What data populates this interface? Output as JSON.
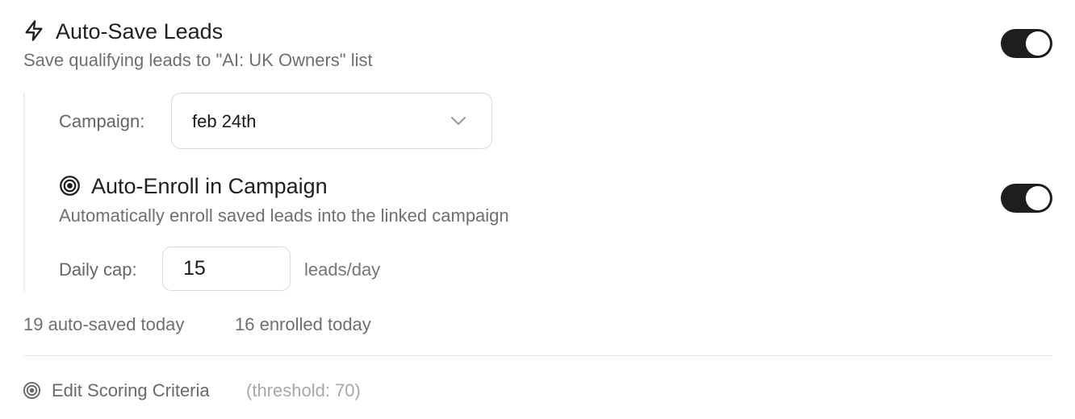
{
  "auto_save": {
    "icon": "bolt-icon",
    "title": "Auto-Save Leads",
    "description": "Save qualifying leads to \"AI: UK Owners\" list",
    "enabled": true
  },
  "campaign": {
    "label": "Campaign:",
    "selected": "feb 24th"
  },
  "auto_enroll": {
    "icon": "target-icon",
    "title": "Auto-Enroll in Campaign",
    "description": "Automatically enroll saved leads into the linked campaign",
    "enabled": true
  },
  "daily_cap": {
    "label": "Daily cap:",
    "value": "15",
    "unit": "leads/day"
  },
  "stats": {
    "auto_saved": "19 auto-saved today",
    "enrolled": "16 enrolled today"
  },
  "scoring": {
    "icon": "target-icon",
    "link_label": "Edit Scoring Criteria",
    "threshold_text": "(threshold: 70)"
  },
  "colors": {
    "toggle_on": "#1e1e1e",
    "text_primary": "#1f1f1f",
    "text_secondary": "#6f6f6f",
    "text_muted": "#a8a8a8",
    "border": "#d9d9d9"
  }
}
